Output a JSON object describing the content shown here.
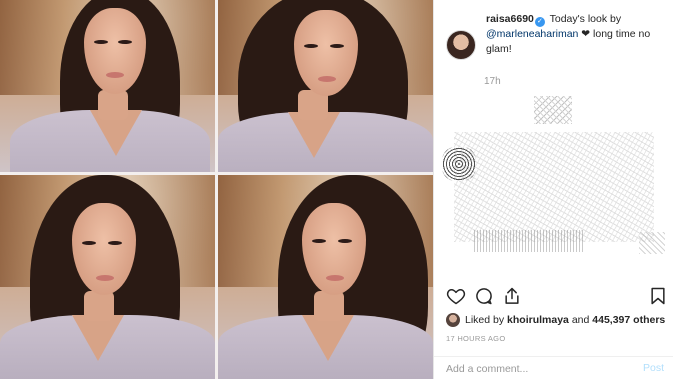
{
  "post": {
    "username": "raisa6690",
    "caption_prefix": "Today's look by",
    "mention": "@marleneahariman",
    "heart": "❤",
    "caption_suffix": "long time no glam!",
    "time_ago": "17h"
  },
  "likes": {
    "prefix": "Liked by",
    "user": "khoirulmaya",
    "and": "and",
    "count": "445,397",
    "suffix": "others"
  },
  "timestamp": "17 HOURS AGO",
  "comment": {
    "placeholder": "Add a comment...",
    "post_label": "Post"
  },
  "icons": {
    "like": "heart-outline-icon",
    "comment": "comment-bubble-icon",
    "share": "share-upload-icon",
    "save": "bookmark-icon",
    "verified": "verified-badge-icon"
  },
  "colors": {
    "verified": "#3897f0",
    "mention": "#003569",
    "muted": "#999999",
    "post_disabled": "#b2dffc"
  }
}
